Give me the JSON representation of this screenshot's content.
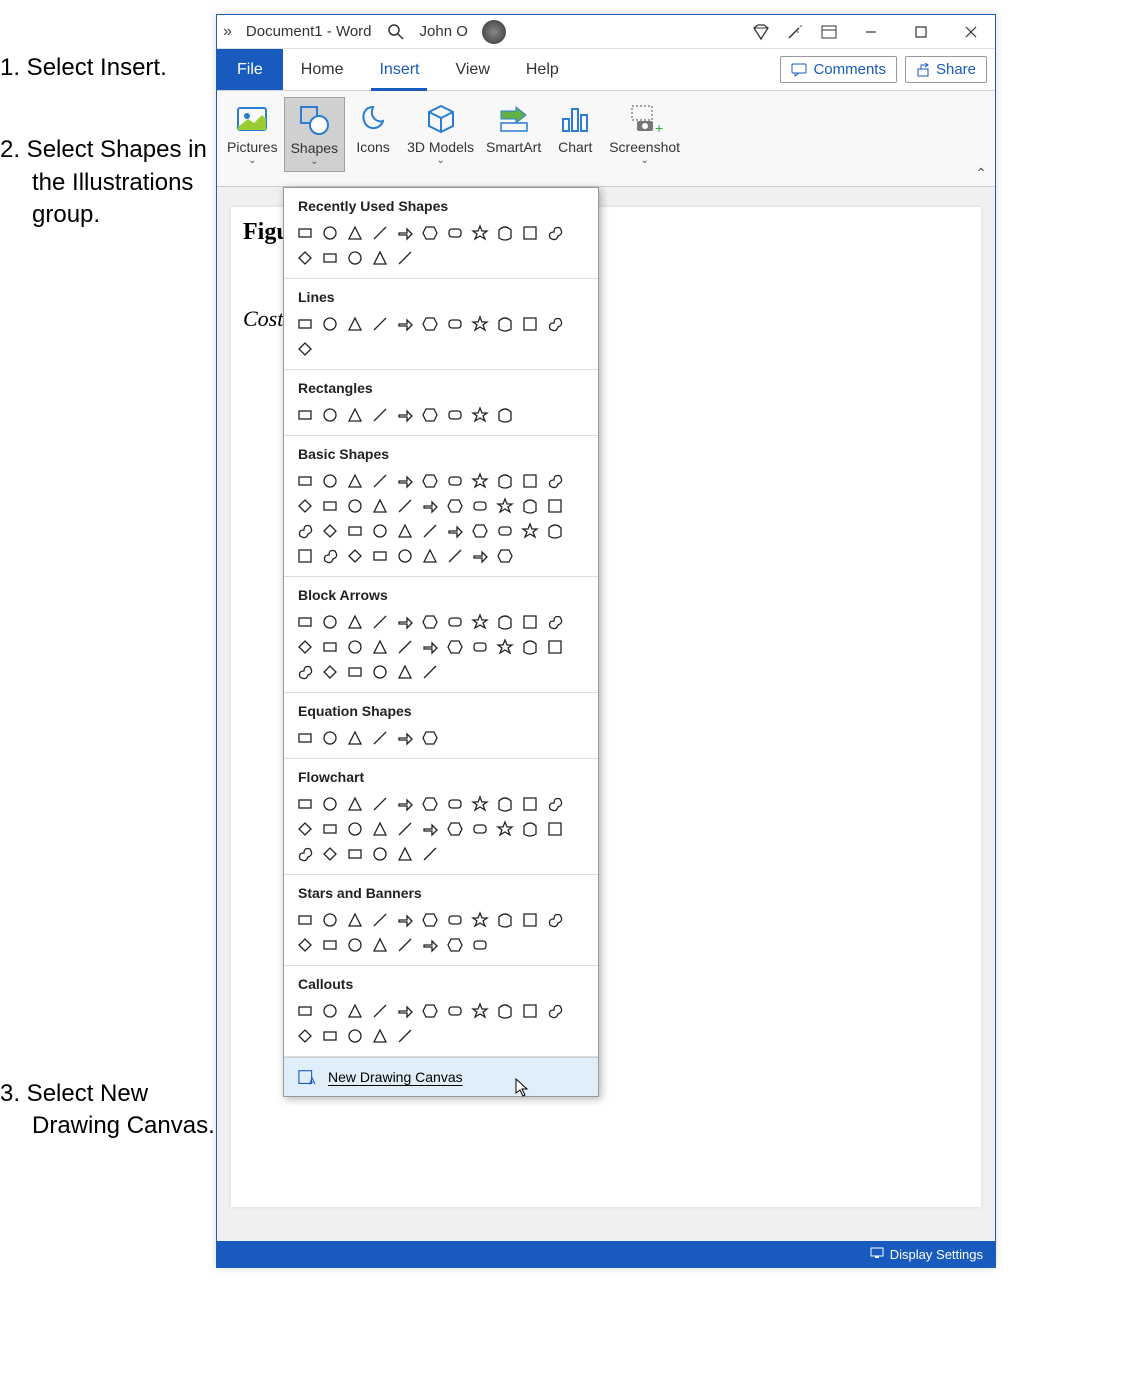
{
  "instructions": {
    "step1": "1. Select Insert.",
    "step2": "2. Select Shapes in the Illustrations group.",
    "step3": "3. Select New Drawing Canvas."
  },
  "titlebar": {
    "chevrons": "»",
    "title": "Document1 - Word",
    "user": "John O"
  },
  "menubar": {
    "file": "File",
    "home": "Home",
    "insert": "Insert",
    "view": "View",
    "help": "Help",
    "comments": "Comments",
    "share": "Share"
  },
  "ribbon": {
    "pictures": "Pictures",
    "shapes": "Shapes",
    "icons": "Icons",
    "models": "3D Models",
    "smartart": "SmartArt",
    "chart": "Chart",
    "screenshot": "Screenshot"
  },
  "document": {
    "figure_label": "Figu",
    "cost_label": "Cost"
  },
  "shapes_dropdown": {
    "recent": "Recently Used Shapes",
    "lines": "Lines",
    "rectangles": "Rectangles",
    "basic": "Basic Shapes",
    "block_arrows": "Block Arrows",
    "equation": "Equation Shapes",
    "flowchart": "Flowchart",
    "stars": "Stars and Banners",
    "callouts": "Callouts",
    "new_canvas": "New Drawing Canvas"
  },
  "statusbar": {
    "display_settings": "Display Settings"
  },
  "counts": {
    "recent": 16,
    "lines": 12,
    "rectangles": 9,
    "basic": 42,
    "block_arrows": 28,
    "equation": 6,
    "flowchart": 28,
    "stars": 19,
    "callouts": 16
  }
}
